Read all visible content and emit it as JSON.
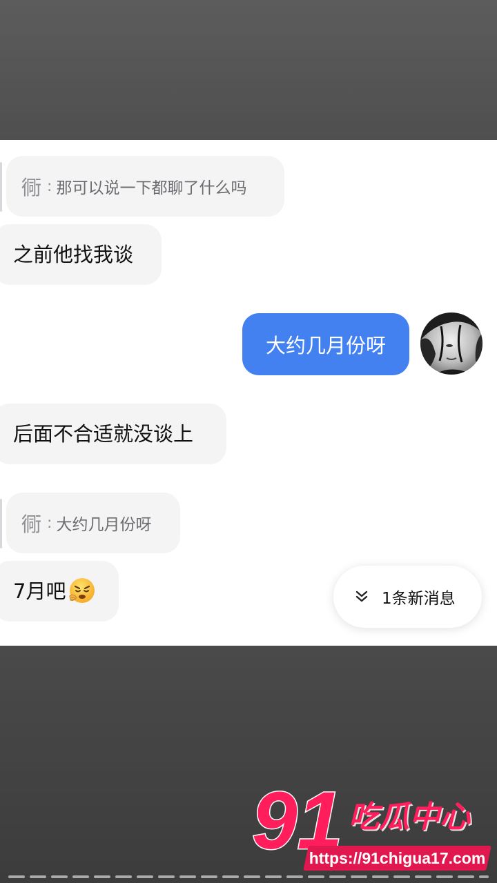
{
  "messages": {
    "quote1": {
      "author": "衕",
      "separator": ":",
      "text": "那可以说一下都聊了什么吗"
    },
    "incoming1": "之前他找我谈",
    "outgoing1": "大约几月份呀",
    "incoming2": "后面不合适就没谈上",
    "quote2": {
      "author": "衕",
      "separator": ":",
      "text": "大约几月份呀"
    },
    "incoming3": "7月吧",
    "incoming3_emoji": "huffing-face-emoji"
  },
  "new_message_pill": {
    "icon": "double-chevron-down-icon",
    "label": "1条新消息"
  },
  "watermark": {
    "number": "91",
    "brand": "吃瓜中心",
    "url": "https://91chigua17.com"
  },
  "colors": {
    "outgoing_bubble": "#4381f1",
    "incoming_bubble": "#f4f4f5",
    "watermark_pink": "#ff1d5c"
  }
}
